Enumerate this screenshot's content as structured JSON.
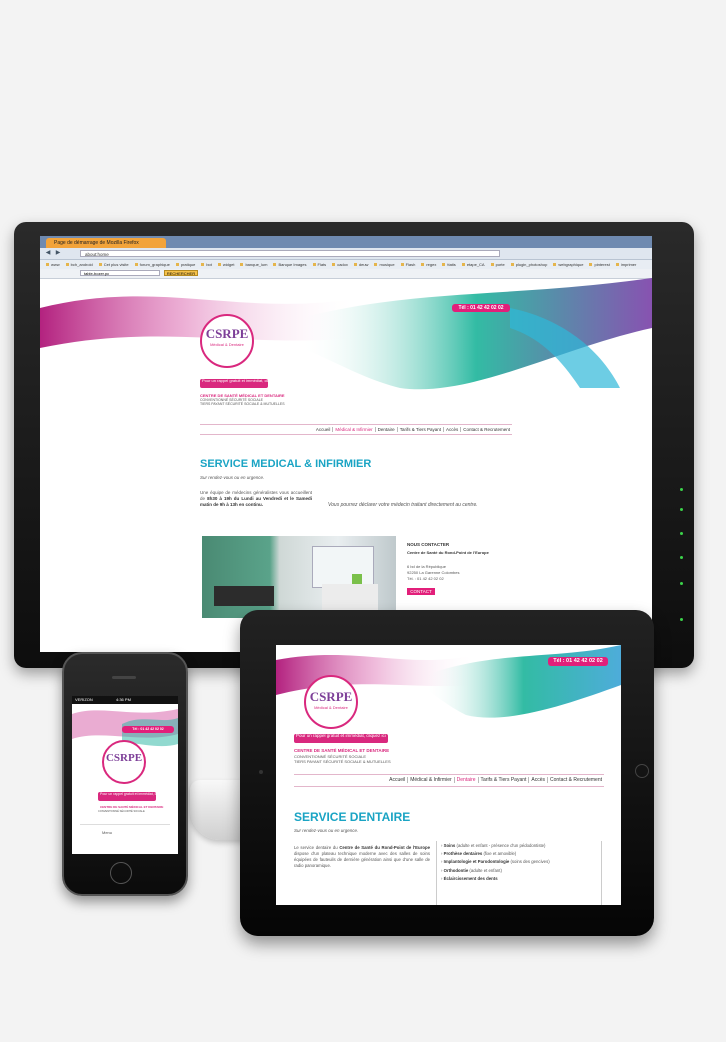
{
  "colors": {
    "brand_pink": "#e21f7a",
    "title_cyan": "#1aa4c4",
    "logo_purple": "#7d3f98"
  },
  "browser": {
    "tab_label": "Page de démarrage de Mozilla Firefox",
    "url": "about:home",
    "nav_back": "◀",
    "nav_forward": "▶",
    "search_value": "table-bozer.pc",
    "search_button": "RECHERCHER",
    "bookmarks": [
      "www",
      "bch_android",
      "Cet plus visite",
      "forum_graphique",
      "pratique",
      "bot",
      "widget",
      "banque_lum",
      "Banque Images",
      "Flats",
      "cadox",
      "deuw",
      "musique",
      "Flash",
      "regex",
      "ttatis",
      "etape_CA",
      "porte",
      "plugin_photoshop",
      "webgraphique",
      "pinterest",
      "imprimer"
    ]
  },
  "site": {
    "phone": "Tél : 01 42 42 02 02",
    "callback": "Pour un rappel gratuit et immédiat, cliquez ici",
    "logo": {
      "ring_text": "Centre de Santé du Rond-Point de l'Europe",
      "monogram": "CSRPE",
      "sub": "Médical & Dentaire"
    },
    "centre_title": "CENTRE DE SANTÉ MÉDICAL ET DENTAIRE",
    "centre_sub_1": "CONVENTIONNÉ SÉCURITÉ SOCIALE",
    "centre_sub_2": "TIERS PAYANT SÉCURITÉ SOCIALE & MUTUELLES",
    "nav": [
      "Accueil",
      "Médical & Infirmier",
      "Dentaire",
      "Tarifs & Tiers Payant",
      "Accès",
      "Contact & Recrutement"
    ]
  },
  "monitor_page": {
    "title": "SERVICE MEDICAL & INFIRMIER",
    "subtitle": "Sur rendez-vous ou en urgence.",
    "paragraph_1": "Une équipe de médecins généralistes vous accueillent de ",
    "paragraph_bold": "8h30 à 19h du Lundi au Vendredi et le Samedi matin de 9h à 13h en continu.",
    "callout": "Vous pourrez déclarer votre médecin traitant directement au centre.",
    "contact_heading": "NOUS CONTACTER",
    "contact_name": "Centre de Santé du Rond-Point de l'Europe",
    "contact_addr_1": "6 bd de la République",
    "contact_addr_2": "92250 La Garenne Colombes",
    "contact_tel": "Tél. : 01 42 42 02 02",
    "contact_button": "CONTACT"
  },
  "tablet_page": {
    "title": "SERVICE DENTAIRE",
    "subtitle": "Sur rendez-vous ou en urgence.",
    "para_a": "Le service dentaire du ",
    "para_b": "Centre de Santé du Rond-Point de l'Europe",
    "para_c": " dispose d'un plateau technique moderne avec des salles de soins équipées de fauteuils de dernière génération ainsi que d'une salle de radio panoramique.",
    "services": [
      {
        "bold": "Soins",
        "rest": " (adulte et enfant - présence d'un pédodontiste)"
      },
      {
        "bold": "Prothèse dentaires",
        "rest": " (fixe et amovible)"
      },
      {
        "bold": "Implantologie et Parodontologie",
        "rest": " (soins des gencives)"
      },
      {
        "bold": "Orthodontie",
        "rest": " (adulte et enfant)"
      },
      {
        "bold": "Éclaircissement des dents",
        "rest": ""
      }
    ]
  },
  "phone_device": {
    "carrier": "VERIZON",
    "time": "4:36 PM",
    "battery": "",
    "footer_link": "Menu"
  }
}
